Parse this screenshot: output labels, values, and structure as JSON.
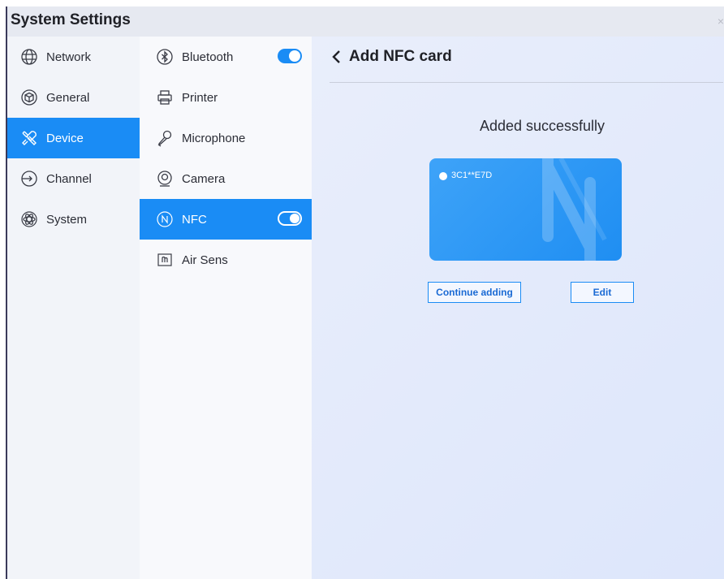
{
  "window": {
    "title": "System Settings",
    "close_glyph": "×"
  },
  "nav": {
    "items": [
      {
        "label": "Network",
        "icon": "globe-icon"
      },
      {
        "label": "General",
        "icon": "cube-icon"
      },
      {
        "label": "Device",
        "icon": "tools-icon",
        "active": true
      },
      {
        "label": "Channel",
        "icon": "input-icon"
      },
      {
        "label": "System",
        "icon": "atom-icon"
      }
    ]
  },
  "device_menu": {
    "items": [
      {
        "label": "Bluetooth",
        "icon": "bluetooth-icon",
        "toggle": true,
        "on": true
      },
      {
        "label": "Printer",
        "icon": "printer-icon"
      },
      {
        "label": "Microphone",
        "icon": "microphone-icon"
      },
      {
        "label": "Camera",
        "icon": "camera-icon"
      },
      {
        "label": "NFC",
        "icon": "nfc-icon",
        "toggle": true,
        "on": true,
        "active": true
      },
      {
        "label": "Air Sens",
        "icon": "air-sensor-icon"
      }
    ]
  },
  "main": {
    "back_title": "Add NFC card",
    "status": "Added successfully",
    "card": {
      "id": "3C1**E7D"
    },
    "buttons": {
      "continue": "Continue adding",
      "edit": "Edit"
    }
  },
  "colors": {
    "accent": "#1a8cf5",
    "card": "#2c98f5",
    "background": "#e4eafb"
  }
}
